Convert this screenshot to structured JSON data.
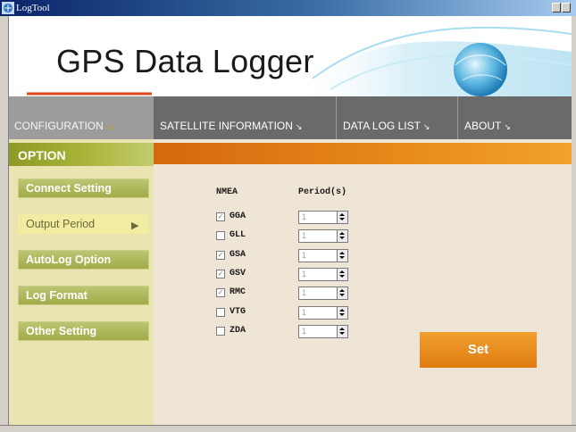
{
  "window": {
    "title": "LogTool"
  },
  "header": {
    "title": "GPS Data Logger"
  },
  "nav": [
    {
      "label": "CONFIGURATION",
      "arrow": "↘",
      "active": true
    },
    {
      "label": "SATELLITE INFORMATION",
      "arrow": "↘"
    },
    {
      "label": "DATA LOG LIST",
      "arrow": "↘"
    },
    {
      "label": "ABOUT",
      "arrow": "↘"
    }
  ],
  "sidebar": {
    "header": "OPTION",
    "items": [
      {
        "label": "Connect Setting"
      },
      {
        "label": "Output Period",
        "active": true,
        "marker": "▶"
      },
      {
        "label": "AutoLog Option"
      },
      {
        "label": "Log Format"
      },
      {
        "label": "Other Setting"
      }
    ]
  },
  "output_period": {
    "col_sentence": "NMEA",
    "col_period": "Period(s)",
    "rows": [
      {
        "name": "GGA",
        "checked": true,
        "period": "1"
      },
      {
        "name": "GLL",
        "checked": false,
        "period": "1"
      },
      {
        "name": "GSA",
        "checked": true,
        "period": "1"
      },
      {
        "name": "GSV",
        "checked": true,
        "period": "1"
      },
      {
        "name": "RMC",
        "checked": true,
        "period": "1"
      },
      {
        "name": "VTG",
        "checked": false,
        "period": "1"
      },
      {
        "name": "ZDA",
        "checked": false,
        "period": "1"
      }
    ],
    "set_label": "Set"
  },
  "colors": {
    "accent": "#e07b12",
    "sidebar_button": "#a0ab48",
    "nav": "#6a6a6a"
  }
}
